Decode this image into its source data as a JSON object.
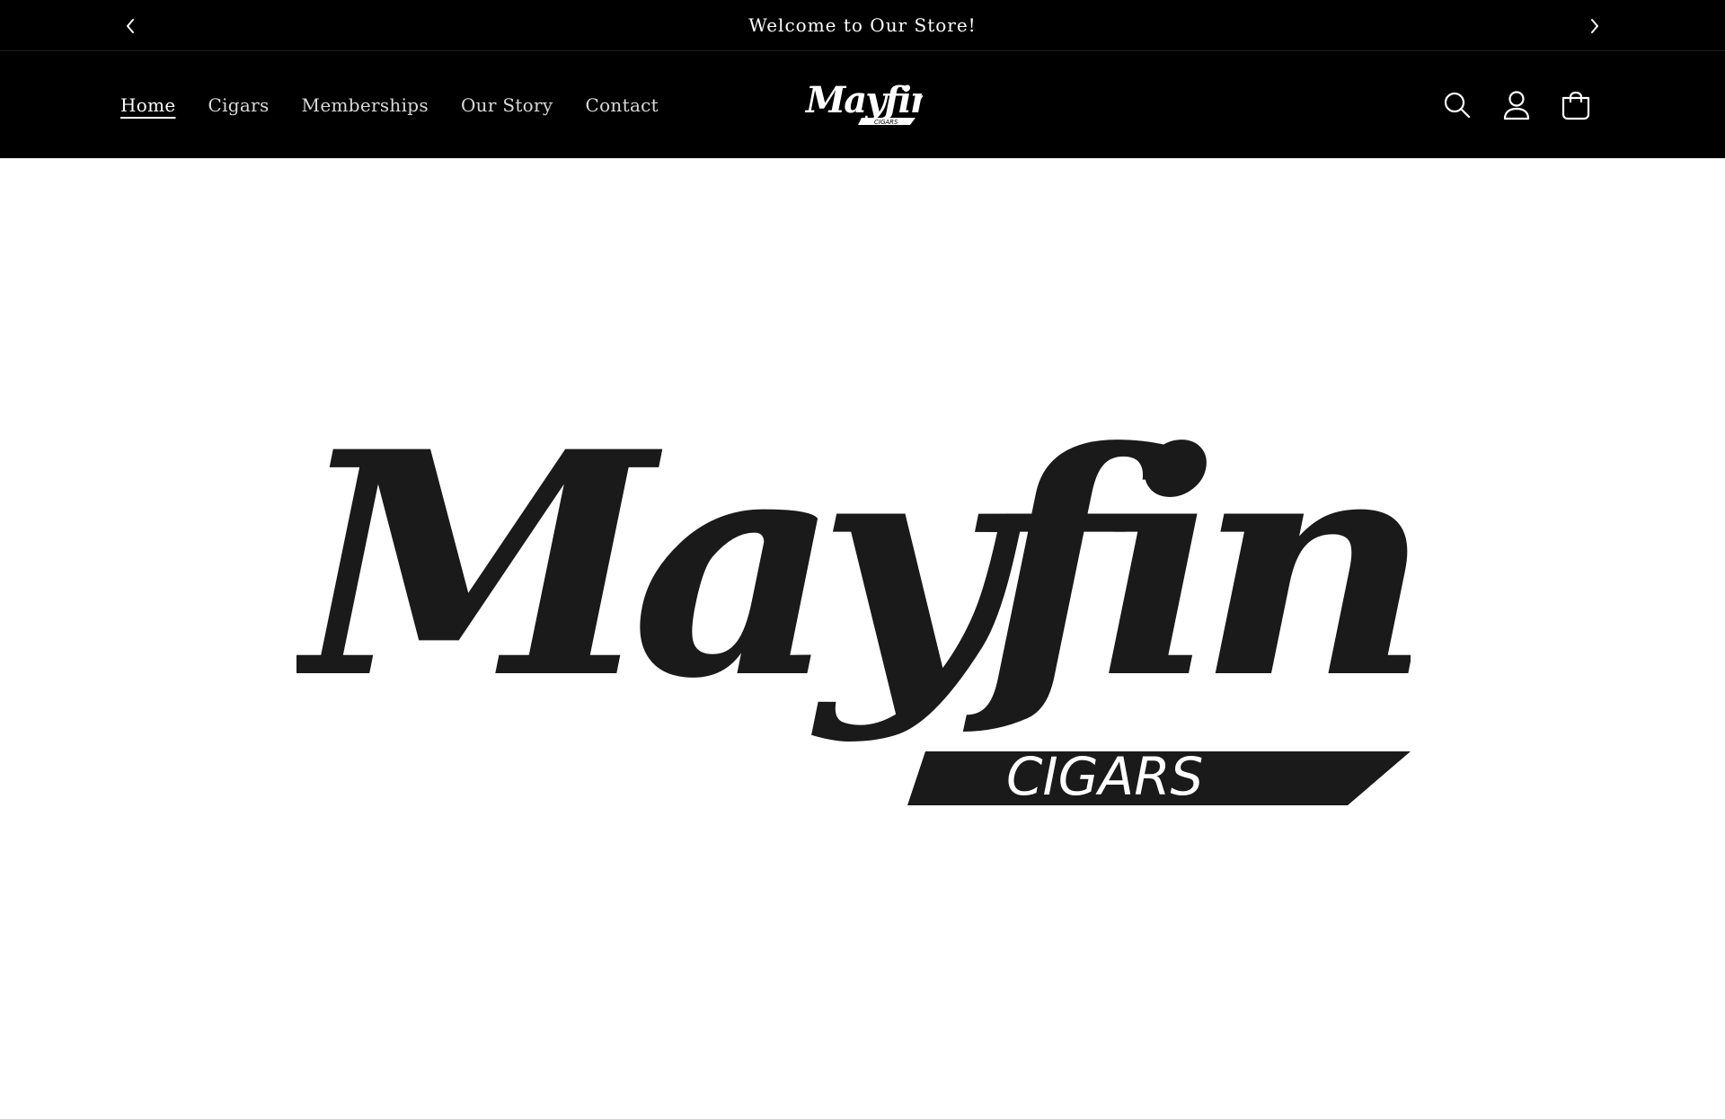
{
  "announcement": {
    "message": "Welcome to Our Store!",
    "prev_icon": "chevron-left-icon",
    "next_icon": "chevron-right-icon"
  },
  "header": {
    "nav": [
      {
        "label": "Home",
        "active": true
      },
      {
        "label": "Cigars",
        "active": false
      },
      {
        "label": "Memberships",
        "active": false
      },
      {
        "label": "Our Story",
        "active": false
      },
      {
        "label": "Contact",
        "active": false
      }
    ],
    "logo": {
      "wordmark": "Mayfin",
      "subtitle": "CIGARS"
    },
    "icons": [
      "search-icon",
      "account-icon",
      "cart-icon"
    ]
  },
  "hero": {
    "logo": {
      "wordmark": "Mayfin",
      "subtitle": "CIGARS"
    }
  },
  "colors": {
    "header_bg": "#000000",
    "nav_text": "#d9d9d9",
    "hero_bg": "#ffffff",
    "logo_dark": "#1b1a1a"
  }
}
